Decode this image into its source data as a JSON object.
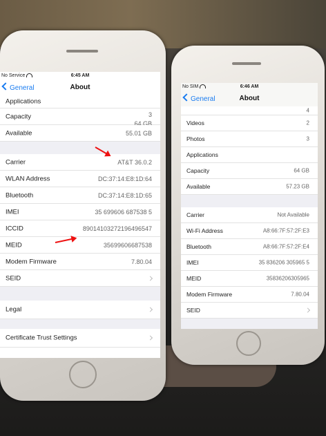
{
  "left_phone": {
    "status": {
      "carrier": "No Service",
      "time": "6:45 AM"
    },
    "nav": {
      "back": "General",
      "title": "About"
    },
    "rows_group1": [
      {
        "label": "Applications",
        "value": "3"
      },
      {
        "label": "Capacity",
        "value": "64 GB"
      },
      {
        "label": "Available",
        "value": "55.01 GB"
      }
    ],
    "rows_group2": [
      {
        "label": "Carrier",
        "value": "AT&T 36.0.2"
      },
      {
        "label": "WLAN Address",
        "value": "DC:37:14:E8:1D:64"
      },
      {
        "label": "Bluetooth",
        "value": "DC:37:14:E8:1D:65"
      },
      {
        "label": "IMEI",
        "value": "35 699606 687538 5"
      },
      {
        "label": "ICCID",
        "value": "89014103272196496547"
      },
      {
        "label": "MEID",
        "value": "35699606687538"
      },
      {
        "label": "Modem Firmware",
        "value": "7.80.04"
      },
      {
        "label": "SEID",
        "value": ""
      }
    ],
    "rows_group3": [
      {
        "label": "Legal"
      }
    ],
    "rows_group4": [
      {
        "label": "Certificate Trust Settings"
      }
    ]
  },
  "right_phone": {
    "status": {
      "carrier": "No SIM",
      "time": "6:46 AM"
    },
    "nav": {
      "back": "General",
      "title": "About"
    },
    "rows_group1": [
      {
        "label": "",
        "value": "4"
      },
      {
        "label": "Videos",
        "value": "2"
      },
      {
        "label": "Photos",
        "value": "3"
      },
      {
        "label": "Applications",
        "value": ""
      },
      {
        "label": "Capacity",
        "value": "64 GB"
      },
      {
        "label": "Available",
        "value": "57.23 GB"
      }
    ],
    "rows_group2": [
      {
        "label": "Carrier",
        "value": "Not Available"
      },
      {
        "label": "Wi-Fi Address",
        "value": "A8:66:7F:57:2F:E3"
      },
      {
        "label": "Bluetooth",
        "value": "A8:66:7F:57:2F:E4"
      },
      {
        "label": "IMEI",
        "value": "35 836206 305965 5"
      },
      {
        "label": "MEID",
        "value": "35836206305965"
      },
      {
        "label": "Modem Firmware",
        "value": "7.80.04"
      },
      {
        "label": "SEID",
        "value": ""
      }
    ]
  },
  "colors": {
    "ios_blue": "#1a7cf0",
    "annotation_red": "#e11111"
  }
}
